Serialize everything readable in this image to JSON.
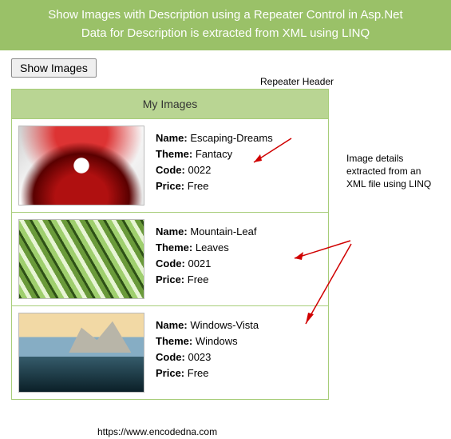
{
  "banner": {
    "line1": "Show Images with Description using a Repeater Control in Asp.Net",
    "line2": "Data for Description is extracted from XML using LINQ"
  },
  "button": {
    "label": "Show Images"
  },
  "repeater": {
    "header": "My Images",
    "field_labels": {
      "name": "Name:",
      "theme": "Theme:",
      "code": "Code:",
      "price": "Price:"
    },
    "rows": [
      {
        "name": "Escaping-Dreams",
        "theme": "Fantacy",
        "code": "0022",
        "price": "Free",
        "art": "art1"
      },
      {
        "name": "Mountain-Leaf",
        "theme": "Leaves",
        "code": "0021",
        "price": "Free",
        "art": "art2"
      },
      {
        "name": "Windows-Vista",
        "theme": "Windows",
        "code": "0023",
        "price": "Free",
        "art": "art3"
      }
    ]
  },
  "annotations": {
    "header": "Repeater Header",
    "details": "Image details extracted from an XML file using LINQ"
  },
  "footer_url": "https://www.encodedna.com"
}
